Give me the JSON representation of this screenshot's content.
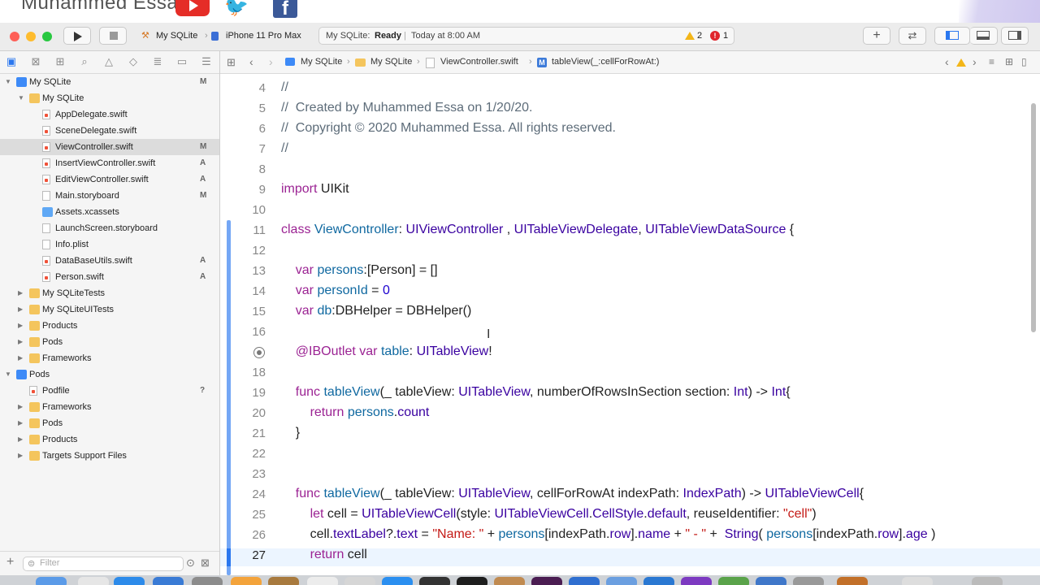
{
  "banner": {
    "author": "Muhammed Essa"
  },
  "toolbar": {
    "scheme_project": "My SQLite",
    "scheme_device": "iPhone 11 Pro Max",
    "activity_project": "My SQLite:",
    "activity_status": "Ready",
    "activity_time": "Today at 8:00 AM",
    "warnings": "2",
    "errors": "1",
    "colors": {
      "close": "#fe5f57",
      "minimize": "#febc2e",
      "zoom": "#28c840",
      "accent": "#2a77ef"
    }
  },
  "navigator": {
    "items": [
      {
        "label": "My SQLite",
        "badge": "M",
        "icon": "project-icon",
        "depth": 0,
        "tri": "▼"
      },
      {
        "label": "My SQLite",
        "badge": "",
        "icon": "folder-icon",
        "depth": 1,
        "tri": "▼"
      },
      {
        "label": "AppDelegate.swift",
        "badge": "",
        "icon": "swift-file-icon",
        "depth": 2,
        "tri": ""
      },
      {
        "label": "SceneDelegate.swift",
        "badge": "",
        "icon": "swift-file-icon",
        "depth": 2,
        "tri": ""
      },
      {
        "label": "ViewController.swift",
        "badge": "M",
        "icon": "swift-file-icon",
        "depth": 2,
        "tri": "",
        "selected": true
      },
      {
        "label": "InsertViewController.swift",
        "badge": "A",
        "icon": "swift-file-icon",
        "depth": 2,
        "tri": ""
      },
      {
        "label": "EditViewController.swift",
        "badge": "A",
        "icon": "swift-file-icon",
        "depth": 2,
        "tri": ""
      },
      {
        "label": "Main.storyboard",
        "badge": "M",
        "icon": "storyboard-icon",
        "depth": 2,
        "tri": ""
      },
      {
        "label": "Assets.xcassets",
        "badge": "",
        "icon": "assets-icon",
        "depth": 2,
        "tri": ""
      },
      {
        "label": "LaunchScreen.storyboard",
        "badge": "",
        "icon": "storyboard-icon",
        "depth": 2,
        "tri": ""
      },
      {
        "label": "Info.plist",
        "badge": "",
        "icon": "plist-icon",
        "depth": 2,
        "tri": ""
      },
      {
        "label": "DataBaseUtils.swift",
        "badge": "A",
        "icon": "swift-file-icon",
        "depth": 2,
        "tri": ""
      },
      {
        "label": "Person.swift",
        "badge": "A",
        "icon": "swift-file-icon",
        "depth": 2,
        "tri": ""
      },
      {
        "label": "My SQLiteTests",
        "badge": "",
        "icon": "folder-icon",
        "depth": 1,
        "tri": "▶"
      },
      {
        "label": "My SQLiteUITests",
        "badge": "",
        "icon": "folder-icon",
        "depth": 1,
        "tri": "▶"
      },
      {
        "label": "Products",
        "badge": "",
        "icon": "folder-icon",
        "depth": 1,
        "tri": "▶"
      },
      {
        "label": "Pods",
        "badge": "",
        "icon": "folder-icon",
        "depth": 1,
        "tri": "▶"
      },
      {
        "label": "Frameworks",
        "badge": "",
        "icon": "folder-icon",
        "depth": 1,
        "tri": "▶"
      },
      {
        "label": "Pods",
        "badge": "",
        "icon": "project-icon",
        "depth": 0,
        "tri": "▼"
      },
      {
        "label": "Podfile",
        "badge": "?",
        "icon": "swift-file-icon",
        "depth": 1,
        "tri": ""
      },
      {
        "label": "Frameworks",
        "badge": "",
        "icon": "folder-icon",
        "depth": 1,
        "tri": "▶"
      },
      {
        "label": "Pods",
        "badge": "",
        "icon": "folder-icon",
        "depth": 1,
        "tri": "▶"
      },
      {
        "label": "Products",
        "badge": "",
        "icon": "folder-icon",
        "depth": 1,
        "tri": "▶"
      },
      {
        "label": "Targets Support Files",
        "badge": "",
        "icon": "folder-icon",
        "depth": 1,
        "tri": "▶"
      }
    ],
    "filter_placeholder": "Filter"
  },
  "jumpbar": {
    "crumbs": [
      "My SQLite",
      "My SQLite",
      "ViewController.swift",
      "tableView(_:cellForRowAt:)"
    ]
  },
  "editor": {
    "current_line": "27",
    "lines": [
      {
        "n": "4",
        "html": "<span class=\"cm\">//</span>"
      },
      {
        "n": "5",
        "html": "<span class=\"cm\">//  Created by Muhammed Essa on 1/20/20.</span>"
      },
      {
        "n": "6",
        "html": "<span class=\"cm\">//  Copyright © 2020 Muhammed Essa. All rights reserved.</span>"
      },
      {
        "n": "7",
        "html": "<span class=\"cm\">//</span>"
      },
      {
        "n": "8",
        "html": ""
      },
      {
        "n": "9",
        "html": "<span class=\"kw\">import</span> UIKit"
      },
      {
        "n": "10",
        "html": ""
      },
      {
        "n": "11",
        "html": "<span class=\"kw\">class</span> <span class=\"id\">ViewController</span>: <span class=\"ty\">UIViewController</span> , <span class=\"ty\">UITableViewDelegate</span>, <span class=\"ty\">UITableViewDataSource</span> {"
      },
      {
        "n": "12",
        "html": ""
      },
      {
        "n": "13",
        "html": "    <span class=\"kw\">var</span> <span class=\"id\">persons</span>:[Person] = []"
      },
      {
        "n": "14",
        "html": "    <span class=\"kw\">var</span> <span class=\"id\">personId</span> = <span class=\"nm\">0</span>"
      },
      {
        "n": "15",
        "html": "    <span class=\"kw\">var</span> <span class=\"id\">db</span>:DBHelper = DBHelper()"
      },
      {
        "n": "16",
        "html": ""
      },
      {
        "n": "",
        "html": "    <span class=\"kw\">@IBOutlet</span> <span class=\"kw\">var</span> <span class=\"id\">table</span>: <span class=\"ty\">UITableView</span>!"
      },
      {
        "n": "18",
        "html": ""
      },
      {
        "n": "19",
        "html": "    <span class=\"kw\">func</span> <span class=\"id\">tableView</span>(_ tableView: <span class=\"ty\">UITableView</span>, numberOfRowsInSection section: <span class=\"ty\">Int</span>) -> <span class=\"ty\">Int</span>{"
      },
      {
        "n": "20",
        "html": "        <span class=\"kw\">return</span> <span class=\"id\">persons</span>.<span class=\"ty\">count</span>"
      },
      {
        "n": "21",
        "html": "    }"
      },
      {
        "n": "22",
        "html": ""
      },
      {
        "n": "23",
        "html": ""
      },
      {
        "n": "24",
        "html": "    <span class=\"kw\">func</span> <span class=\"id\">tableView</span>(_ tableView: <span class=\"ty\">UITableView</span>, cellForRowAt indexPath: <span class=\"ty\">IndexPath</span>) -> <span class=\"ty\">UITableViewCell</span>{"
      },
      {
        "n": "25",
        "html": "        <span class=\"kw\">let</span> cell = <span class=\"ty\">UITableViewCell</span>(style: <span class=\"ty\">UITableViewCell</span>.<span class=\"ty\">CellStyle</span>.<span class=\"ty\">default</span>, reuseIdentifier: <span class=\"st\">\"cell\"</span>)"
      },
      {
        "n": "26",
        "html": "        cell.<span class=\"ty\">textLabel</span>?.<span class=\"ty\">text</span> = <span class=\"st\">\"Name: \"</span> + <span class=\"id\">persons</span>[indexPath.<span class=\"ty\">row</span>].<span class=\"ty\">name</span> + <span class=\"st\">\" - \"</span> +  <span class=\"ty\">String</span>( <span class=\"id\">persons</span>[indexPath.<span class=\"ty\">row</span>].<span class=\"ty\">age</span> )"
      },
      {
        "n": "27",
        "html": "        <span class=\"kw\">return</span> cell"
      }
    ]
  }
}
